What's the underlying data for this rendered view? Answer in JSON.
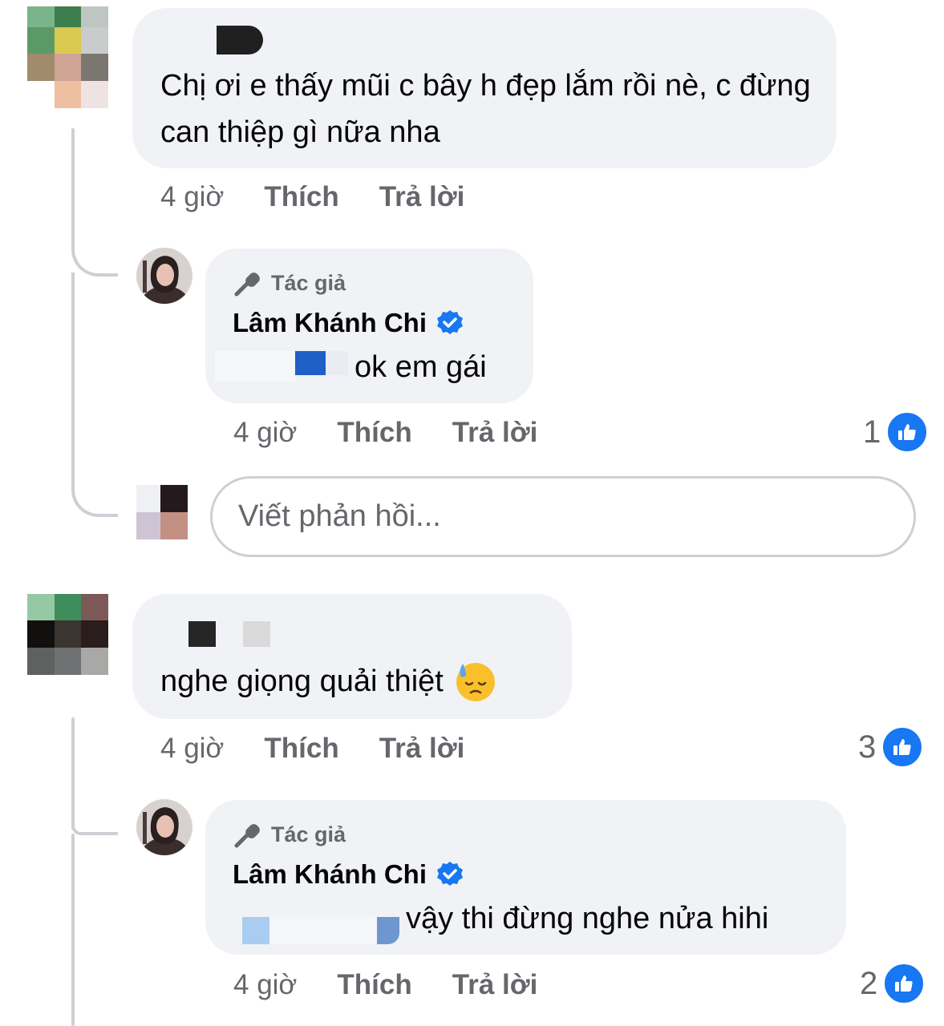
{
  "comments": [
    {
      "text": "Chị ơi e thấy mũi c bây h đẹp lắm rồi nè, c đừng can thiệp gì nữa nha",
      "time": "4 giờ",
      "like_label": "Thích",
      "reply_label": "Trả lời",
      "reply": {
        "badge": "Tác giả",
        "name": "Lâm Khánh Chi",
        "text": "ok em gái",
        "time": "4 giờ",
        "like_label": "Thích",
        "reply_label": "Trả lời",
        "reaction_count": "1"
      },
      "reply_input_placeholder": "Viết phản hồi..."
    },
    {
      "text": "nghe giọng quải thiệt",
      "emoji": "😓",
      "time": "4 giờ",
      "like_label": "Thích",
      "reply_label": "Trả lời",
      "reaction_count": "3",
      "reply": {
        "badge": "Tác giả",
        "name": "Lâm Khánh Chi",
        "text": "vậy thi đừng nghe nửa hihi",
        "time": "4 giờ",
        "like_label": "Thích",
        "reply_label": "Trả lời",
        "reaction_count": "2"
      }
    }
  ],
  "icons": {
    "author_badge": "microphone-icon",
    "verified": "verified-badge-icon",
    "like": "thumbs-up-icon"
  },
  "colors": {
    "bubble": "#f0f2f5",
    "accent": "#1877f2",
    "secondary_text": "#65676b"
  }
}
